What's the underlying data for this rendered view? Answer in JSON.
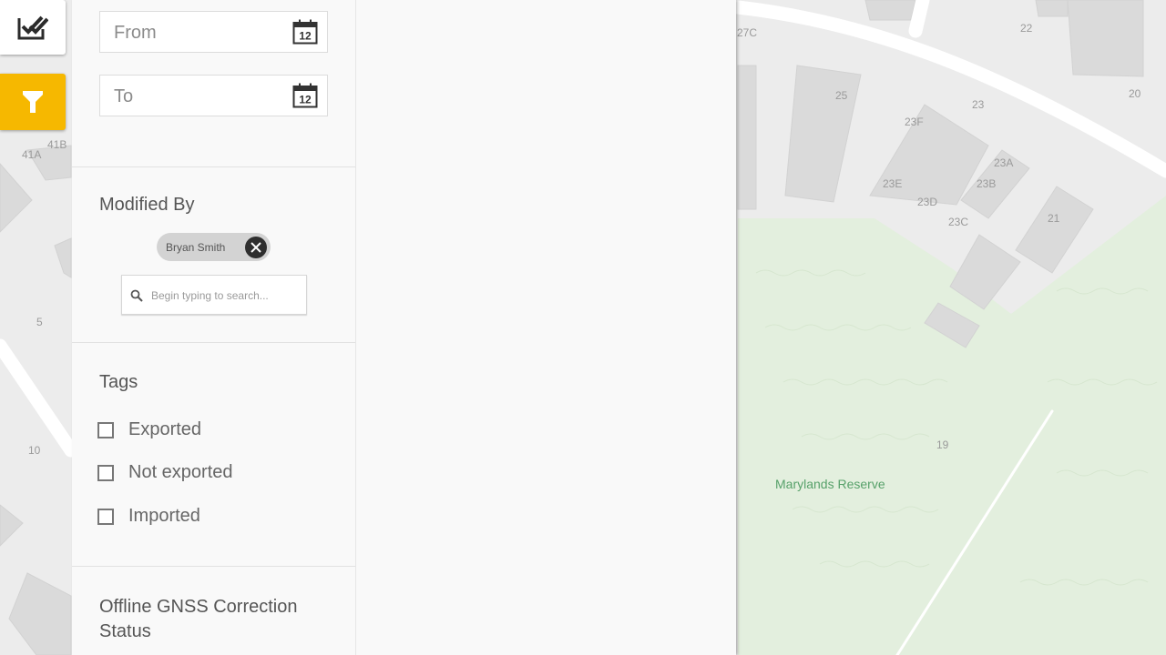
{
  "map": {
    "lot_numbers": [
      "27C",
      "22",
      "20",
      "25",
      "23",
      "23F",
      "23A",
      "23E",
      "23D",
      "23B",
      "23C",
      "21",
      "41A",
      "41B",
      "5",
      "10",
      "19"
    ],
    "park_name": "Marylands Reserve",
    "park_icon": "tree-icon",
    "colors": {
      "land": "#ececec",
      "building": "#dadada",
      "road": "#ffffff",
      "park": "#e3efde",
      "park_label": "#57a16a"
    }
  },
  "toolbar": {
    "checklist_icon": "double-check-icon",
    "filter_icon": "filter-icon",
    "filter_color": "#f6b800"
  },
  "filters": {
    "date_from": {
      "placeholder": "From",
      "icon": "calendar-icon",
      "icon_text": "12"
    },
    "date_to": {
      "placeholder": "To",
      "icon": "calendar-icon",
      "icon_text": "12"
    },
    "modified_by": {
      "title": "Modified By",
      "chips": [
        {
          "label": "Bryan Smith"
        }
      ],
      "search_placeholder": "Begin typing to search..."
    },
    "tags": {
      "title": "Tags",
      "options": [
        {
          "label": "Exported",
          "checked": false
        },
        {
          "label": "Not exported",
          "checked": false
        },
        {
          "label": "Imported",
          "checked": false
        }
      ]
    },
    "gnss": {
      "title_line1": "Offline GNSS Correction",
      "title_line2": "Status"
    }
  }
}
